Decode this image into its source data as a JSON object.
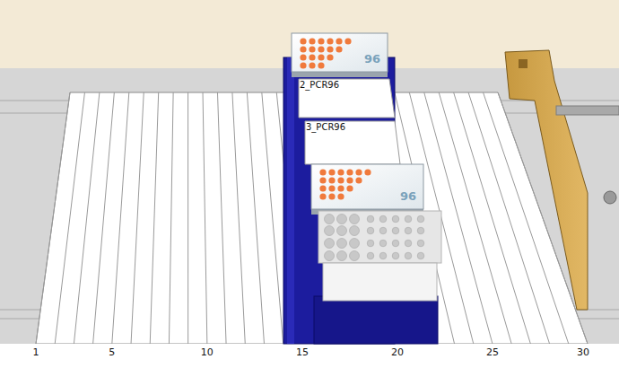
{
  "deck": {
    "ruler": [
      "1",
      "5",
      "10",
      "15",
      "20",
      "25",
      "30"
    ]
  },
  "labware": [
    {
      "kind": "plate",
      "label": "",
      "badge": "96"
    },
    {
      "kind": "empty",
      "label": "2_PCR96",
      "badge": ""
    },
    {
      "kind": "empty",
      "label": "3_PCR96",
      "badge": ""
    },
    {
      "kind": "plate",
      "label": "",
      "badge": "96"
    },
    {
      "kind": "tuberack",
      "label": "",
      "badge": ""
    }
  ]
}
